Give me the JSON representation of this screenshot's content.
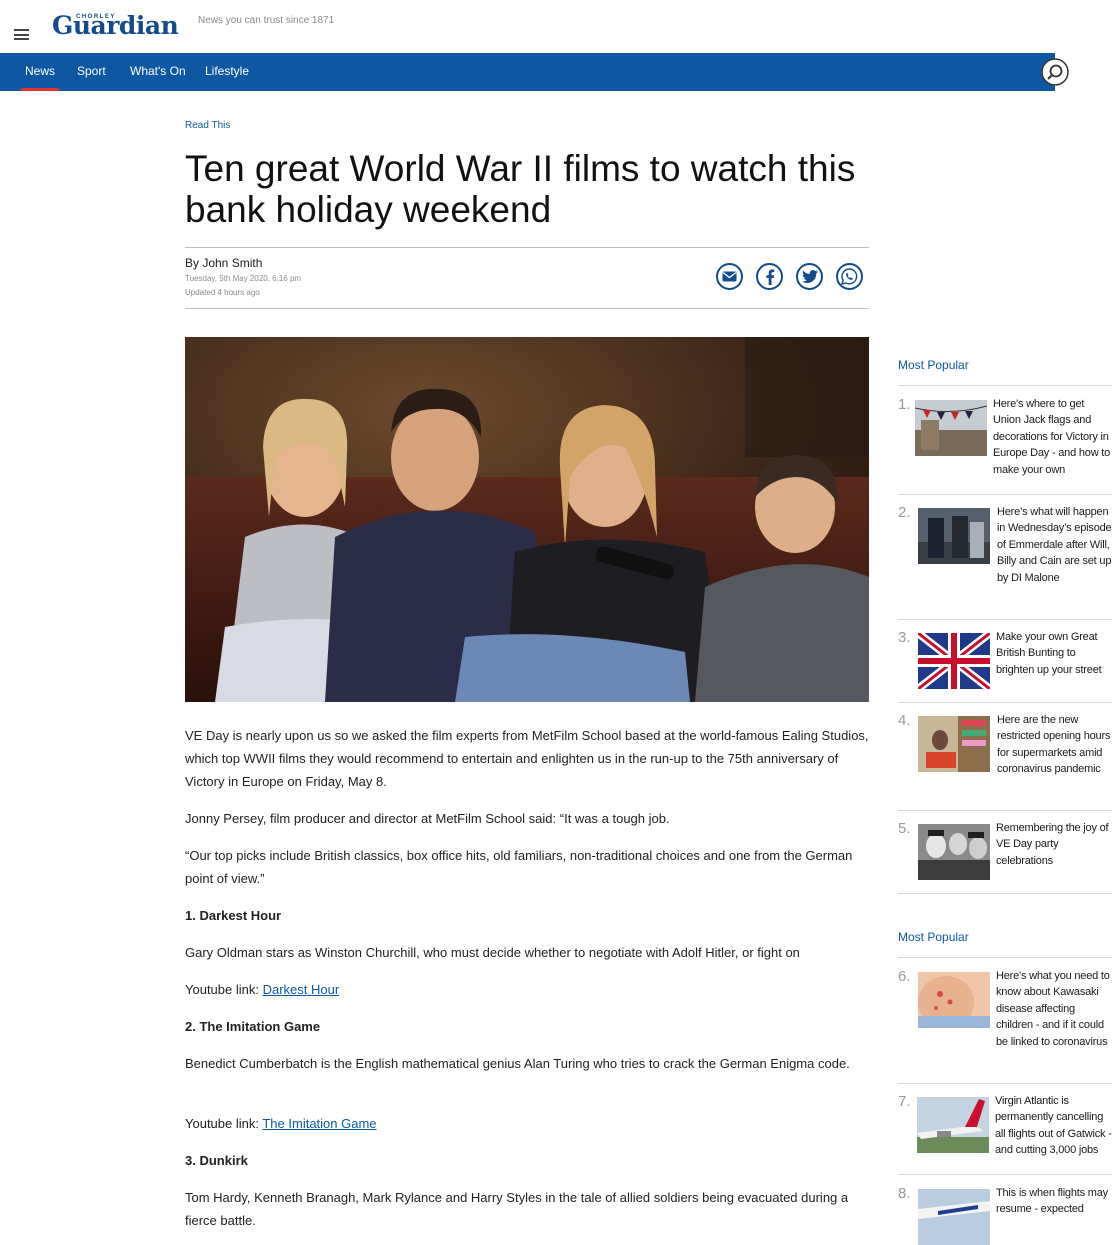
{
  "header": {
    "logo_top": "CHORLEY",
    "logo": "Guardian",
    "tagline": "News you can trust since 1871",
    "nav": [
      "News",
      "Sport",
      "What's On",
      "Lifestyle"
    ]
  },
  "article": {
    "kicker": "Read This",
    "headline": "Ten great World War II films to watch this bank holiday weekend",
    "byline": "By John Smith",
    "published": "Tuesday, 5th May 2020, 6:16 pm",
    "updated": "Updated  4 hours ago",
    "paragraphs": [
      "VE Day is nearly upon us so we asked the film experts from MetFilm School based at the world-famous Ealing Studios, which top WWII films they would recommend to entertain and enlighten us in the run-up to the 75th anniversary of Victory in Europe on Friday, May 8.",
      "Jonny Persey, film producer and director at MetFilm School said: “It was a tough job.",
      "“Our top picks include British classics, box office hits, old familiars, non-traditional choices and one from the German point of view.”",
      "1. Darkest Hour",
      "Gary Oldman stars as Winston Churchill, who must decide whether to negotiate with Adolf Hitler, or fight on",
      "Youtube link: ",
      "Darkest Hour",
      "2. The Imitation Game",
      "Benedict Cumberbatch is the English mathematical genius Alan Turing who tries to crack the German Enigma code.",
      "Youtube link: ",
      "The Imitation Game",
      "3. Dunkirk",
      "Tom Hardy, Kenneth Branagh, Mark Rylance and Harry Styles in the tale of allied soldiers being evacuated during a fierce battle."
    ]
  },
  "sidebar": {
    "heading1": "Most Popular",
    "heading2": "Most Popular",
    "items": [
      {
        "num": "1.",
        "title": "Here's where to get Union Jack flags and decorations for Victory in Europe Day - and how to make your own"
      },
      {
        "num": "2.",
        "title": "Here’s what will happen in Wednesday’s episode of Emmerdale after Will, Billy and Cain are set up by DI Malone"
      },
      {
        "num": "3.",
        "title": "Make your own Great British Bunting to brighten up your street"
      },
      {
        "num": "4.",
        "title": "Here are the new restricted opening hours for supermarkets amid coronavirus pandemic"
      },
      {
        "num": "5.",
        "title": "Remembering the joy of VE Day party celebrations"
      },
      {
        "num": "6.",
        "title": "Here's what you need to know about Kawasaki disease affecting children - and if it could be linked to coronavirus"
      },
      {
        "num": "7.",
        "title": "Virgin Atlantic is permanently cancelling all flights out of Gatwick - and cutting 3,000 jobs"
      },
      {
        "num": "8.",
        "title": "This is when flights may resume - expected"
      }
    ]
  },
  "colors": {
    "brand": "#124c8f",
    "nav": "#0e58a3",
    "accent": "#e1322e"
  }
}
